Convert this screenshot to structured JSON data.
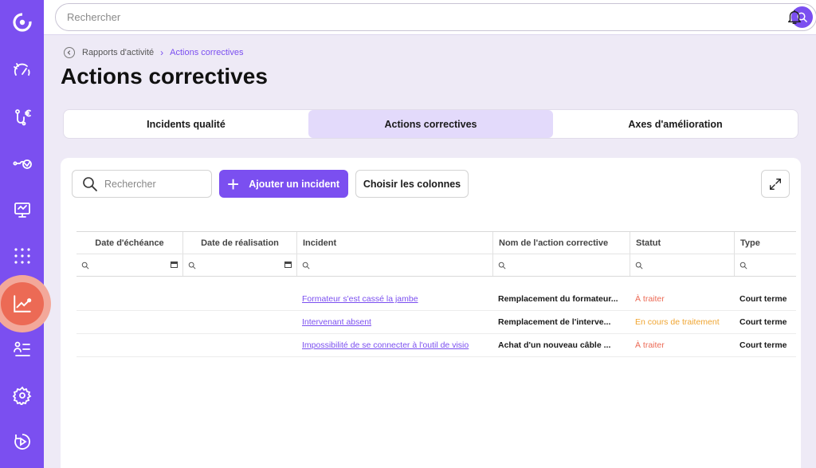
{
  "app": {
    "brand_color": "#7b4ff0",
    "accent_color": "#ec6a55"
  },
  "sidebar": {
    "items": [
      {
        "icon": "logo-icon"
      },
      {
        "icon": "speed-gauge-icon"
      },
      {
        "icon": "finance-path-icon"
      },
      {
        "icon": "flow-check-icon"
      },
      {
        "icon": "presentation-board-icon"
      },
      {
        "icon": "dots-grid-icon"
      },
      {
        "icon": "activity-chart-icon",
        "active": true
      },
      {
        "icon": "people-list-icon"
      },
      {
        "icon": "settings-gear-icon"
      },
      {
        "icon": "help-play-icon"
      }
    ]
  },
  "topbar": {
    "search_placeholder": "Rechercher"
  },
  "breadcrumb": {
    "parent": "Rapports d'activité",
    "current": "Actions correctives"
  },
  "page_title": "Actions correctives",
  "tabs": [
    {
      "label": "Incidents qualité",
      "active": false
    },
    {
      "label": "Actions correctives",
      "active": true
    },
    {
      "label": "Axes d'amélioration",
      "active": false
    }
  ],
  "toolbar": {
    "search_placeholder": "Rechercher",
    "add_label": "Ajouter un incident",
    "columns_label": "Choisir les colonnes"
  },
  "table": {
    "headers": [
      "Date d'échéance",
      "Date de réalisation",
      "Incident",
      "Nom de l'action corrective",
      "Statut",
      "Type"
    ],
    "rows": [
      {
        "due": "",
        "done": "",
        "incident": "Formateur s'est cassé la jambe",
        "action": "Remplacement du formateur...",
        "status": "À traiter",
        "status_color": "#ec6a55",
        "type": "Court terme"
      },
      {
        "due": "",
        "done": "",
        "incident": "Intervenant absent",
        "action": "Remplacement de l'interve...",
        "status": "En cours de traitement",
        "status_color": "#f0a531",
        "type": "Court terme"
      },
      {
        "due": "",
        "done": "",
        "incident": "Impossibilité de se connecter à l'outil de visio",
        "action": "Achat d'un nouveau câble ...",
        "status": "À traiter",
        "status_color": "#ec6a55",
        "type": "Court terme"
      }
    ]
  }
}
